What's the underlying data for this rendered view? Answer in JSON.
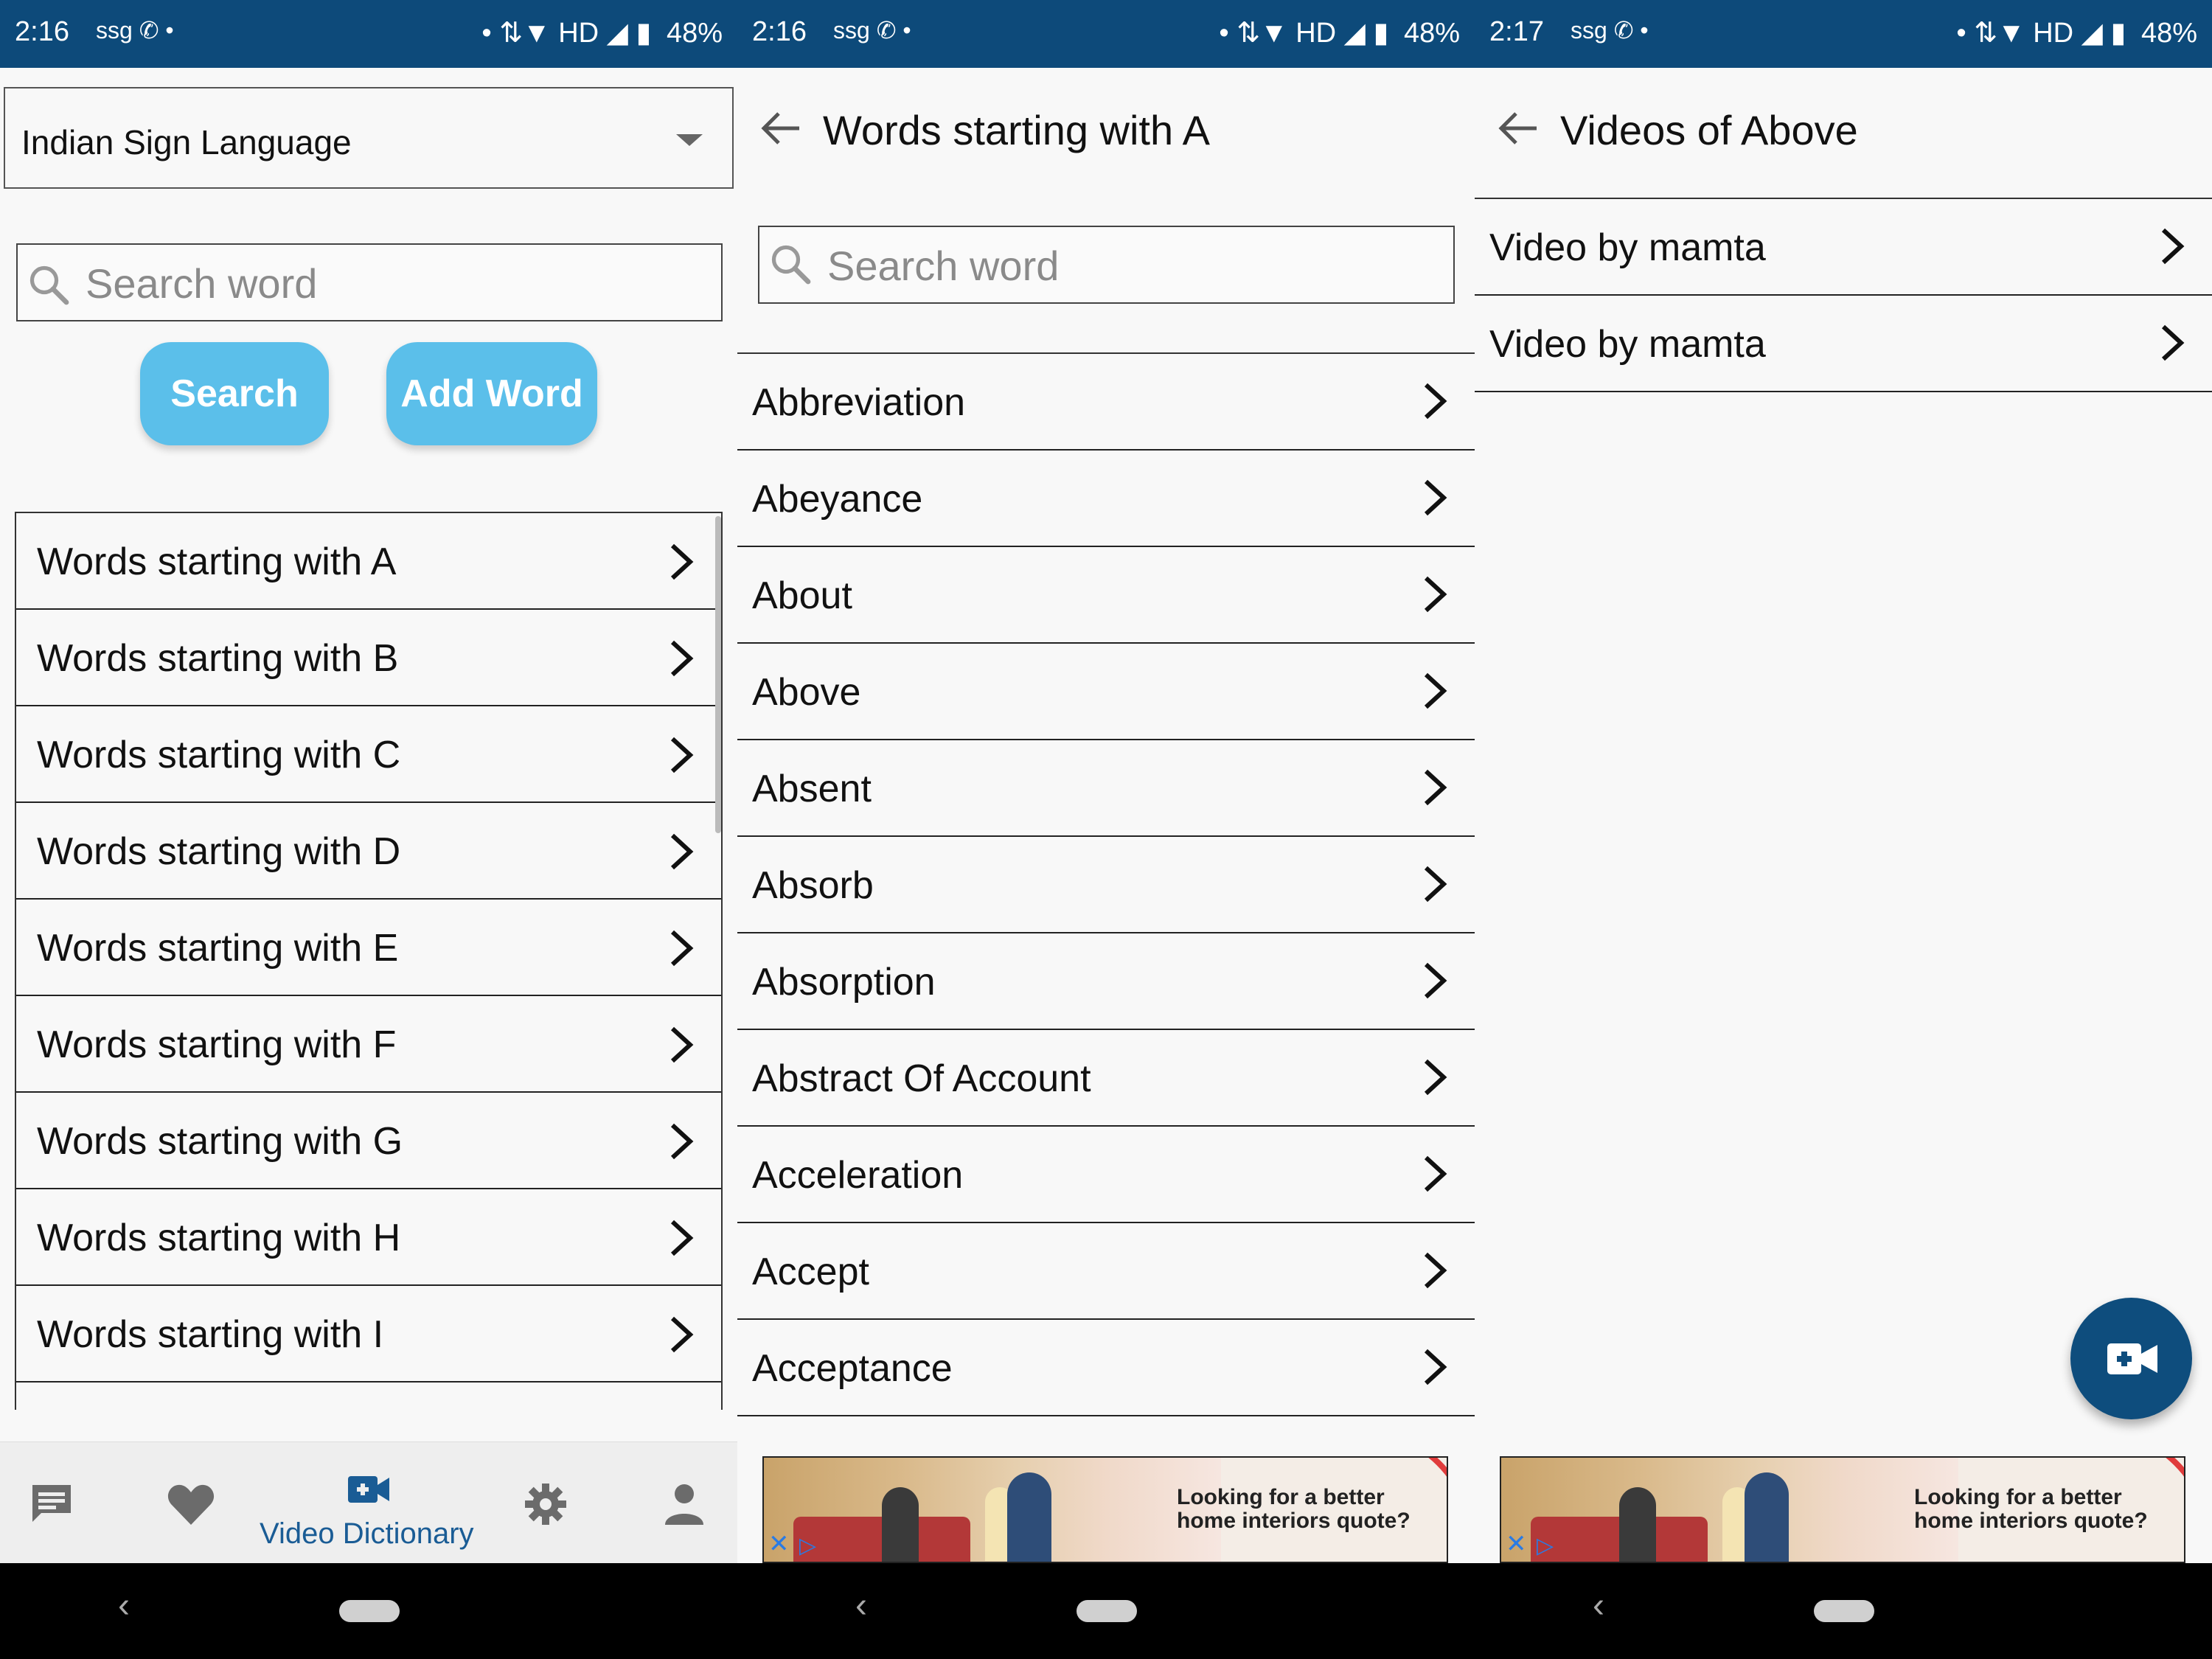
{
  "status_bars": [
    {
      "time": "2:16",
      "left_icons": "ssg ✆ •",
      "right_icons": "• ⇅▼ HD ◢ ▮",
      "battery": "48%"
    },
    {
      "time": "2:16",
      "left_icons": "ssg ✆ •",
      "right_icons": "• ⇅▼ HD ◢ ▮",
      "battery": "48%"
    },
    {
      "time": "2:17",
      "left_icons": "ssg ✆ •",
      "right_icons": "• ⇅▼ HD ◢ ▮",
      "battery": "48%"
    }
  ],
  "panel1": {
    "language_select": "Indian Sign Language",
    "search_placeholder": "Search word",
    "search_button": "Search",
    "add_word_button": "Add Word",
    "letters": [
      "Words starting with A",
      "Words starting with B",
      "Words starting with C",
      "Words starting with D",
      "Words starting with E",
      "Words starting with F",
      "Words starting with G",
      "Words starting with H",
      "Words starting with I"
    ],
    "bottom_nav": {
      "active_label": "Video Dictionary",
      "items": [
        "chat-icon",
        "heart-icon",
        "video-camera-icon",
        "gear-icon",
        "person-icon"
      ]
    }
  },
  "panel2": {
    "title": "Words starting with A",
    "search_placeholder": "Search word",
    "words": [
      "Abbreviation",
      "Abeyance",
      "About",
      "Above",
      "Absent",
      "Absorb",
      "Absorption",
      "Abstract Of Account",
      "Acceleration",
      "Accept",
      "Acceptance"
    ],
    "ad_text": "Looking for a better home interiors quote?"
  },
  "panel3": {
    "title": "Videos of Above",
    "videos": [
      "Video by mamta",
      "Video by mamta"
    ],
    "ad_text": "Looking for a better home interiors quote?"
  },
  "colors": {
    "status_bar": "#0d4a7a",
    "button_blue": "#5bbfea",
    "fab": "#0e4d7d",
    "nav_active": "#1a5c95"
  }
}
